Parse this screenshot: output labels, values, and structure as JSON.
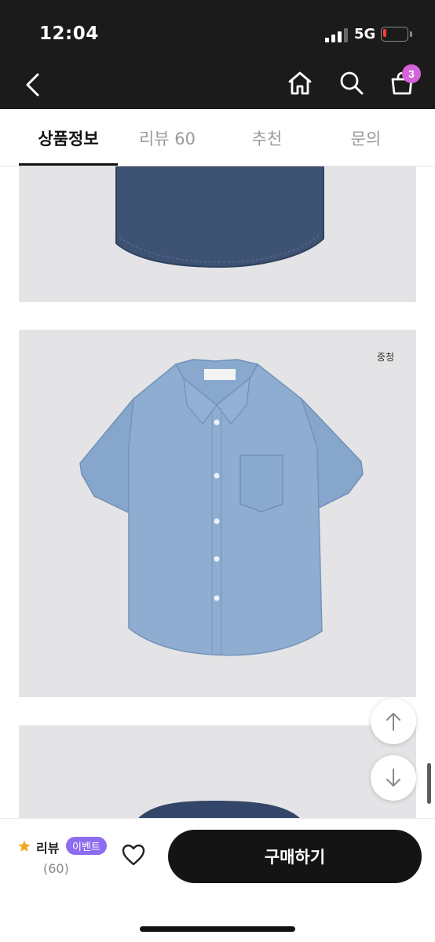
{
  "status_bar": {
    "time": "12:04",
    "network": "5G",
    "battery_level": "low"
  },
  "nav": {
    "back_icon": "chevron-left-icon",
    "home_icon": "home-icon",
    "search_icon": "search-icon",
    "cart_icon": "shopping-bag-icon",
    "cart_count": "3"
  },
  "tabs": [
    {
      "label": "상품정보",
      "active": true
    },
    {
      "label": "리뷰 60",
      "active": false
    },
    {
      "label": "추천",
      "active": false
    },
    {
      "label": "문의",
      "active": false
    }
  ],
  "content": {
    "color_label": "중청"
  },
  "bottom_bar": {
    "review_label": "리뷰",
    "event_badge": "이벤트",
    "review_count": "(60)",
    "buy_label": "구매하기"
  },
  "colors": {
    "dark": "#1b1b1b",
    "badge": "#d462d8",
    "event": "#8d6cf0",
    "star": "#f5a623"
  }
}
